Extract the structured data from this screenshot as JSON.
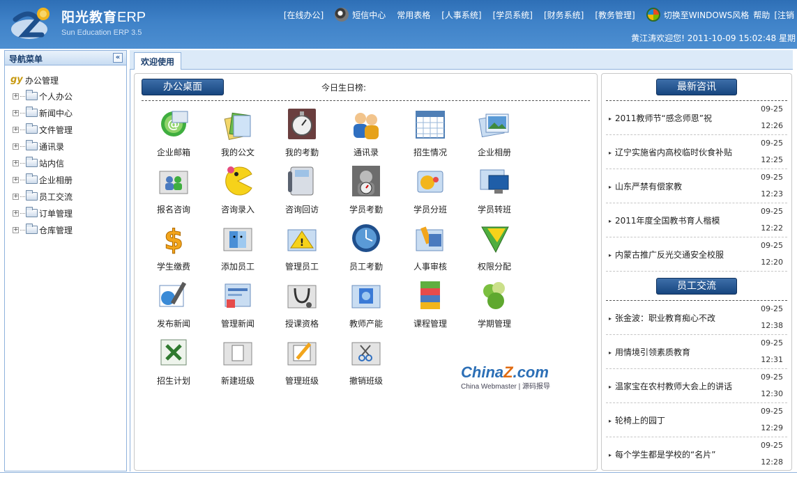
{
  "header": {
    "title_cn": "阳光教育",
    "title_erp": "ERP",
    "subtitle": "Sun Education ERP 3.5",
    "nav": [
      {
        "label": "[在线办公]",
        "icon": ""
      },
      {
        "label": "短信中心",
        "icon": "message-icon"
      },
      {
        "label": "常用表格",
        "icon": ""
      },
      {
        "label": "[人事系统]",
        "icon": ""
      },
      {
        "label": "[学员系统]",
        "icon": ""
      },
      {
        "label": "[财务系统]",
        "icon": ""
      },
      {
        "label": "[教务管理]",
        "icon": ""
      },
      {
        "label": "切换至WINDOWS风格",
        "icon": "windows-icon"
      },
      {
        "label": "帮助",
        "icon": ""
      },
      {
        "label": "[注销",
        "icon": ""
      }
    ],
    "welcome": "黄江涛欢迎您! 2011-10-09 15:02:48 星期"
  },
  "sidebar": {
    "title": "导航菜单",
    "collapse": "«",
    "root": "办公管理",
    "items": [
      "个人办公",
      "新闻中心",
      "文件管理",
      "通讯录",
      "站内信",
      "企业相册",
      "员工交流",
      "订单管理",
      "仓库管理"
    ]
  },
  "tabs": {
    "active": "欢迎使用"
  },
  "desktop": {
    "title": "办公桌面",
    "birthday_label": "今日生日榜:",
    "apps": [
      {
        "label": "企业邮箱",
        "icon": "mail-icon"
      },
      {
        "label": "我的公文",
        "icon": "documents-icon"
      },
      {
        "label": "我的考勤",
        "icon": "stopwatch-icon"
      },
      {
        "label": "通讯录",
        "icon": "contacts-icon"
      },
      {
        "label": "招生情况",
        "icon": "calendar-icon"
      },
      {
        "label": "企业相册",
        "icon": "photos-icon"
      },
      {
        "label": "报名咨询",
        "icon": "users-folder-icon"
      },
      {
        "label": "咨询录入",
        "icon": "pacman-icon"
      },
      {
        "label": "咨询回访",
        "icon": "phone-icon"
      },
      {
        "label": "学员考勤",
        "icon": "clock-person-icon"
      },
      {
        "label": "学员分班",
        "icon": "game-folder-icon"
      },
      {
        "label": "学员转班",
        "icon": "computer-folder-icon"
      },
      {
        "label": "学生缴费",
        "icon": "dollar-icon"
      },
      {
        "label": "添加员工",
        "icon": "finder-icon"
      },
      {
        "label": "管理员工",
        "icon": "warning-folder-icon"
      },
      {
        "label": "员工考勤",
        "icon": "globe-clock-icon"
      },
      {
        "label": "人事审核",
        "icon": "rules-icon"
      },
      {
        "label": "权限分配",
        "icon": "flag-icon"
      },
      {
        "label": "发布新闻",
        "icon": "news-write-icon"
      },
      {
        "label": "管理新闻",
        "icon": "news-manage-icon"
      },
      {
        "label": "授课资格",
        "icon": "stethoscope-icon"
      },
      {
        "label": "教师产能",
        "icon": "finder-folder-icon"
      },
      {
        "label": "课程管理",
        "icon": "books-icon"
      },
      {
        "label": "学期管理",
        "icon": "apples-icon"
      },
      {
        "label": "招生计划",
        "icon": "excel-icon"
      },
      {
        "label": "新建班级",
        "icon": "new-file-icon"
      },
      {
        "label": "管理班级",
        "icon": "edit-folder-icon"
      },
      {
        "label": "撤销班级",
        "icon": "scissors-icon"
      }
    ],
    "watermark": {
      "main_a": "China",
      "main_z": "Z",
      "main_b": ".com",
      "sub": "China Webmaster | 源码报导"
    }
  },
  "news": {
    "title": "最新咨讯",
    "items": [
      {
        "text": "2011教师节“感念师恩”祝",
        "date": "09-25",
        "time": "12:26"
      },
      {
        "text": "辽宁实施省内高校临时伙食补贴",
        "date": "09-25",
        "time": "12:25"
      },
      {
        "text": "山东严禁有偿家教",
        "date": "09-25",
        "time": "12:23"
      },
      {
        "text": "2011年度全国教书育人楷模",
        "date": "09-25",
        "time": "12:22"
      },
      {
        "text": "内蒙古推广反光交通安全校服",
        "date": "09-25",
        "time": "12:20"
      }
    ]
  },
  "staff": {
    "title": "员工交流",
    "items": [
      {
        "text": "张金波：职业教育痴心不改",
        "date": "09-25",
        "time": "12:38"
      },
      {
        "text": "用情境引领素质教育",
        "date": "09-25",
        "time": "12:31"
      },
      {
        "text": "温家宝在农村教师大会上的讲话",
        "date": "09-25",
        "time": "12:30"
      },
      {
        "text": "轮椅上的园丁",
        "date": "09-25",
        "time": "12:29"
      },
      {
        "text": "每个学生都是学校的“名片”",
        "date": "09-25",
        "time": "12:28"
      }
    ]
  }
}
